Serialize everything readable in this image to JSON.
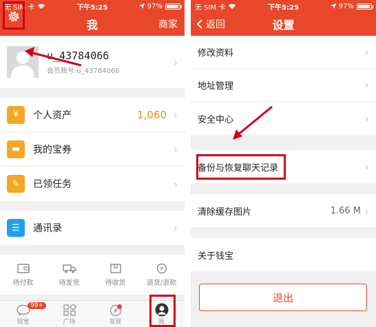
{
  "colors": {
    "brand": "#e8472a",
    "highlight": "#d0021b",
    "asset_value": "#f08a1c"
  },
  "left": {
    "status": {
      "carrier": "无 SIM 卡",
      "time": "下午5:25",
      "battery": "97%",
      "battery_level": 0.97
    },
    "nav": {
      "title": "我",
      "right": "商家",
      "settings_icon": "gear-icon"
    },
    "profile": {
      "username": "u_43784066",
      "account": "会员账号:u_43784066"
    },
    "assets_group": [
      {
        "icon": "money-bag-icon",
        "color": "#f5a623",
        "glyph": "¥",
        "label": "个人资产",
        "value": "1,060"
      },
      {
        "icon": "coupon-icon",
        "color": "#f5a623",
        "glyph": "▬",
        "label": "我的宝券",
        "value": ""
      },
      {
        "icon": "task-icon",
        "color": "#f5a623",
        "glyph": "✎",
        "label": "已领任务",
        "value": ""
      }
    ],
    "contacts": {
      "icon": "contacts-icon",
      "color": "#1ea1f2",
      "glyph": "☰",
      "label": "通讯录"
    },
    "orders": [
      {
        "icon": "wallet-icon",
        "label": "待付款"
      },
      {
        "icon": "truck-icon",
        "label": "待发货"
      },
      {
        "icon": "box-icon",
        "label": "待收货"
      },
      {
        "icon": "refund-icon",
        "label": "退货/退款"
      }
    ],
    "tabs": [
      {
        "icon": "chat-icon",
        "label": "钱宝",
        "badge": "99+"
      },
      {
        "icon": "grid-icon",
        "label": "广场"
      },
      {
        "icon": "compass-icon",
        "label": "发现"
      },
      {
        "icon": "user-icon",
        "label": "我"
      }
    ]
  },
  "right": {
    "status": {
      "carrier": "无 SIM 卡",
      "time": "下午5:25",
      "battery": "97%",
      "battery_level": 0.97
    },
    "nav": {
      "back": "返回",
      "title": "设置"
    },
    "group1": [
      "修改资料",
      "地址管理",
      "安全中心"
    ],
    "backup": "备份与恢复聊天记录",
    "cache": {
      "label": "清除缓存图片",
      "value": "1.66 M"
    },
    "about": "关于钱宝",
    "logout": "退出"
  }
}
